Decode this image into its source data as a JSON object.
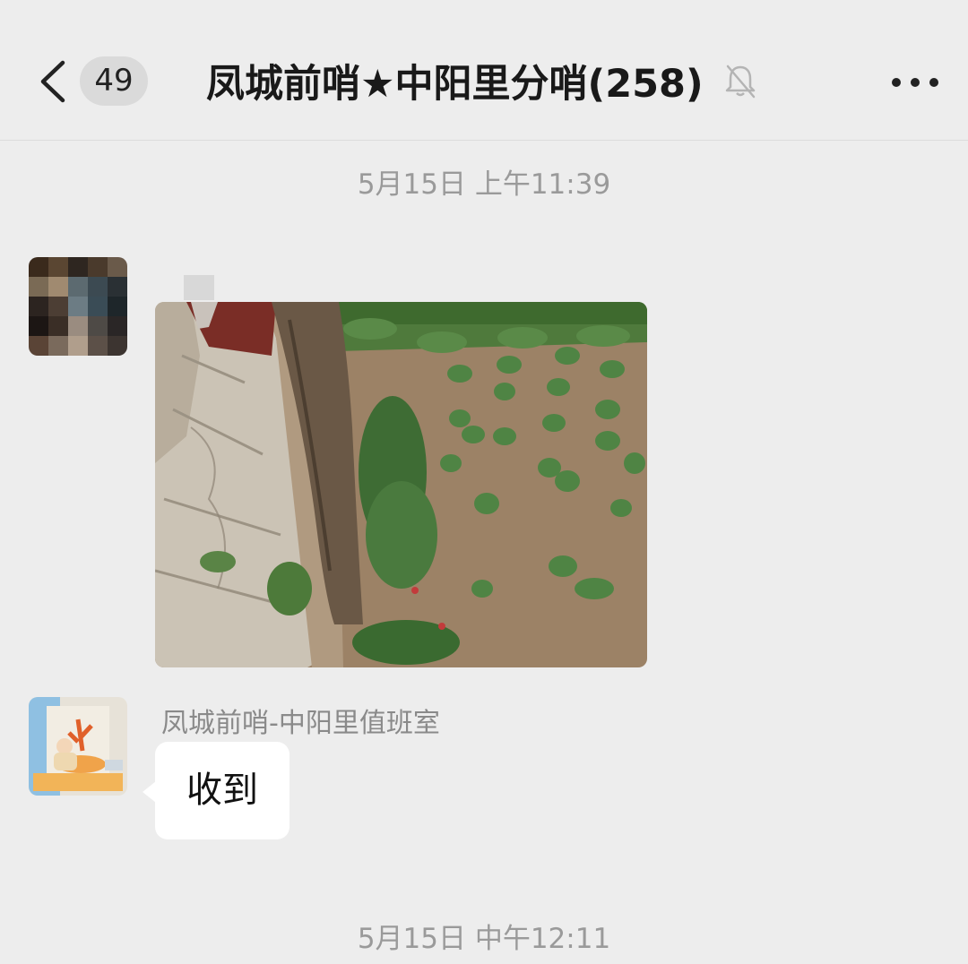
{
  "header": {
    "unread_count": "49",
    "title": "凤城前哨★中阳里分哨(258)",
    "back_icon": "chevron-left-icon",
    "mute_icon": "bell-muted-icon",
    "more_icon": "more-dots-icon"
  },
  "messages": [
    {
      "type": "timestamp",
      "text": "5月15日 上午11:39"
    },
    {
      "type": "image",
      "sender_avatar": "pixelated-avatar",
      "content": "photo"
    },
    {
      "type": "text",
      "sender": "凤城前哨-中阳里值班室",
      "sender_avatar": "illustration-avatar",
      "text": "收到"
    },
    {
      "type": "timestamp",
      "text": "5月15日 中午12:11"
    }
  ],
  "colors": {
    "background": "#ededed",
    "bubble": "#ffffff",
    "timestamp": "#9a9a9a",
    "sender_name": "#8a8a8a"
  }
}
